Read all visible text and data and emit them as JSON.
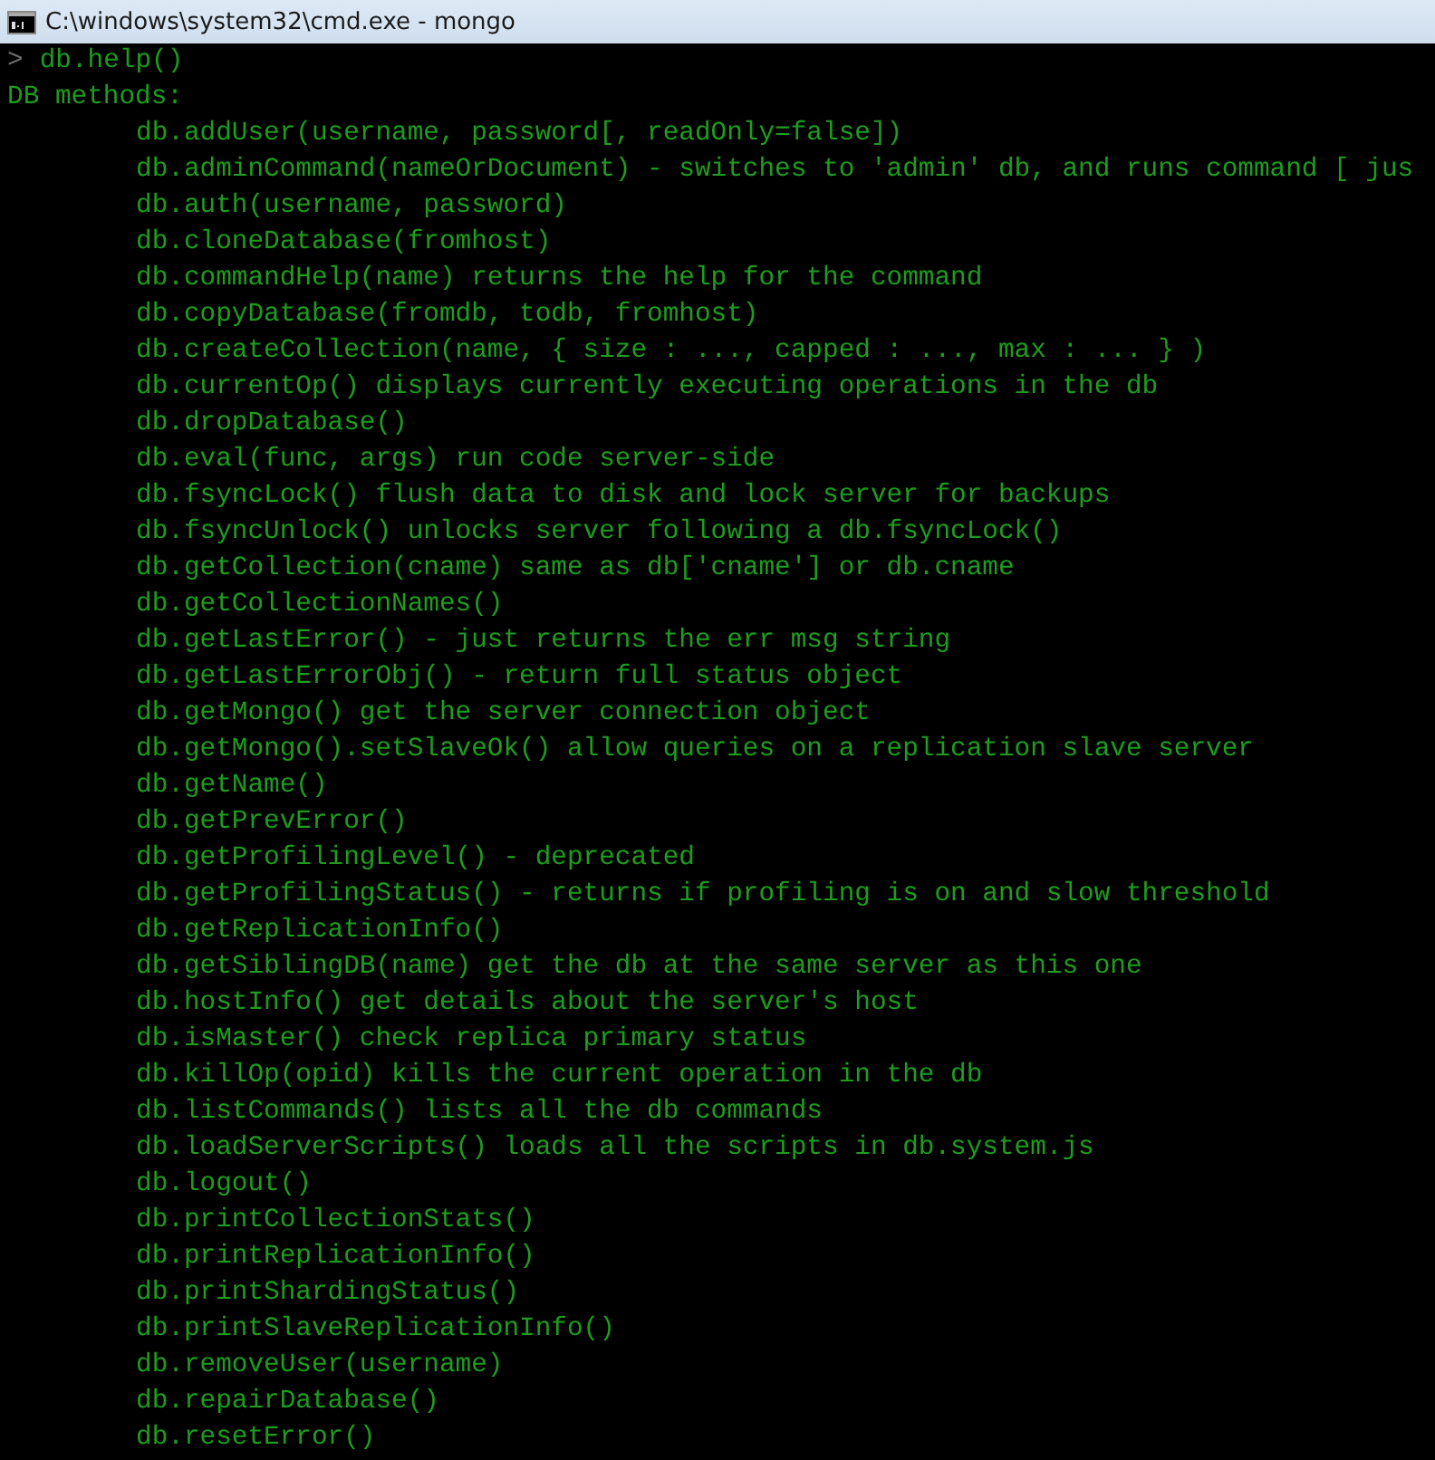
{
  "window": {
    "title": "C:\\windows\\system32\\cmd.exe - mongo"
  },
  "console": {
    "lines": [
      {
        "kind": "prompt",
        "symbol": ">",
        "text": "db.help()"
      },
      {
        "kind": "heading",
        "text": "DB methods:"
      },
      {
        "kind": "method",
        "text": "db.addUser(username, password[, readOnly=false])"
      },
      {
        "kind": "method",
        "text": "db.adminCommand(nameOrDocument) - switches to 'admin' db, and runs command [ jus"
      },
      {
        "kind": "method",
        "text": "db.auth(username, password)"
      },
      {
        "kind": "method",
        "text": "db.cloneDatabase(fromhost)"
      },
      {
        "kind": "method",
        "text": "db.commandHelp(name) returns the help for the command"
      },
      {
        "kind": "method",
        "text": "db.copyDatabase(fromdb, todb, fromhost)"
      },
      {
        "kind": "method",
        "text": "db.createCollection(name, { size : ..., capped : ..., max : ... } )"
      },
      {
        "kind": "method",
        "text": "db.currentOp() displays currently executing operations in the db"
      },
      {
        "kind": "method",
        "text": "db.dropDatabase()"
      },
      {
        "kind": "method",
        "text": "db.eval(func, args) run code server-side"
      },
      {
        "kind": "method",
        "text": "db.fsyncLock() flush data to disk and lock server for backups"
      },
      {
        "kind": "method",
        "text": "db.fsyncUnlock() unlocks server following a db.fsyncLock()"
      },
      {
        "kind": "method",
        "text": "db.getCollection(cname) same as db['cname'] or db.cname"
      },
      {
        "kind": "method",
        "text": "db.getCollectionNames()"
      },
      {
        "kind": "method",
        "text": "db.getLastError() - just returns the err msg string"
      },
      {
        "kind": "method",
        "text": "db.getLastErrorObj() - return full status object"
      },
      {
        "kind": "method",
        "text": "db.getMongo() get the server connection object"
      },
      {
        "kind": "method",
        "text": "db.getMongo().setSlaveOk() allow queries on a replication slave server"
      },
      {
        "kind": "method",
        "text": "db.getName()"
      },
      {
        "kind": "method",
        "text": "db.getPrevError()"
      },
      {
        "kind": "method",
        "text": "db.getProfilingLevel() - deprecated"
      },
      {
        "kind": "method",
        "text": "db.getProfilingStatus() - returns if profiling is on and slow threshold"
      },
      {
        "kind": "method",
        "text": "db.getReplicationInfo()"
      },
      {
        "kind": "method",
        "text": "db.getSiblingDB(name) get the db at the same server as this one"
      },
      {
        "kind": "method",
        "text": "db.hostInfo() get details about the server's host"
      },
      {
        "kind": "method",
        "text": "db.isMaster() check replica primary status"
      },
      {
        "kind": "method",
        "text": "db.killOp(opid) kills the current operation in the db"
      },
      {
        "kind": "method",
        "text": "db.listCommands() lists all the db commands"
      },
      {
        "kind": "method",
        "text": "db.loadServerScripts() loads all the scripts in db.system.js"
      },
      {
        "kind": "method",
        "text": "db.logout()"
      },
      {
        "kind": "method",
        "text": "db.printCollectionStats()"
      },
      {
        "kind": "method",
        "text": "db.printReplicationInfo()"
      },
      {
        "kind": "method",
        "text": "db.printShardingStatus()"
      },
      {
        "kind": "method",
        "text": "db.printSlaveReplicationInfo()"
      },
      {
        "kind": "method",
        "text": "db.removeUser(username)"
      },
      {
        "kind": "method",
        "text": "db.repairDatabase()"
      },
      {
        "kind": "method",
        "text": "db.resetError()"
      }
    ]
  }
}
